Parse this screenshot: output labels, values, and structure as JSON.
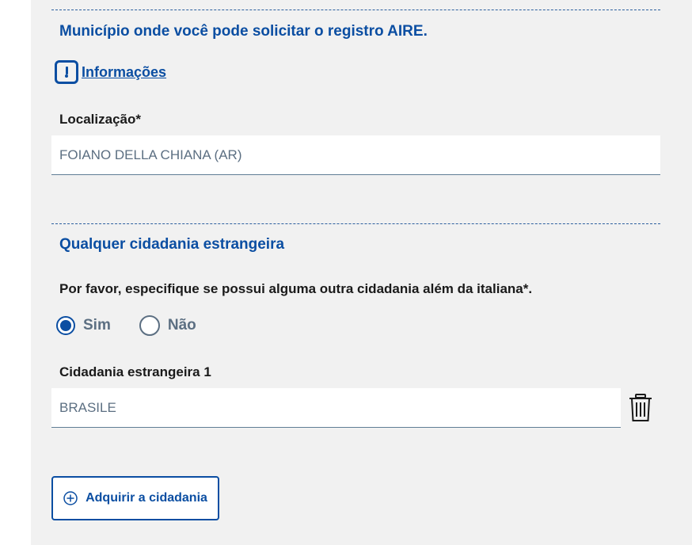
{
  "colors": {
    "accent": "#0b4ea2",
    "panel_background": "#f1f1f1",
    "muted_text": "#5c6f82"
  },
  "municipality_section": {
    "title": "Município onde você pode solicitar o registro AIRE.",
    "info_icon": "exclamation-square-icon",
    "info_link": "Informações",
    "location_label": "Localização*",
    "location_value": "FOIANO DELLA CHIANA (AR)"
  },
  "citizenship_section": {
    "title": "Qualquer cidadania estrangeira",
    "question": "Por favor, especifique se possui alguma outra cidadania além da italiana*.",
    "options": [
      {
        "label": "Sim",
        "selected": true
      },
      {
        "label": "Não",
        "selected": false
      }
    ],
    "foreign_citizenship_label": "Cidadania estrangeira 1",
    "foreign_citizenship_value": "BRASILE",
    "delete_icon": "trash-icon",
    "add_icon": "plus-circle-icon",
    "add_button_label": "Adquirir a cidadania"
  }
}
